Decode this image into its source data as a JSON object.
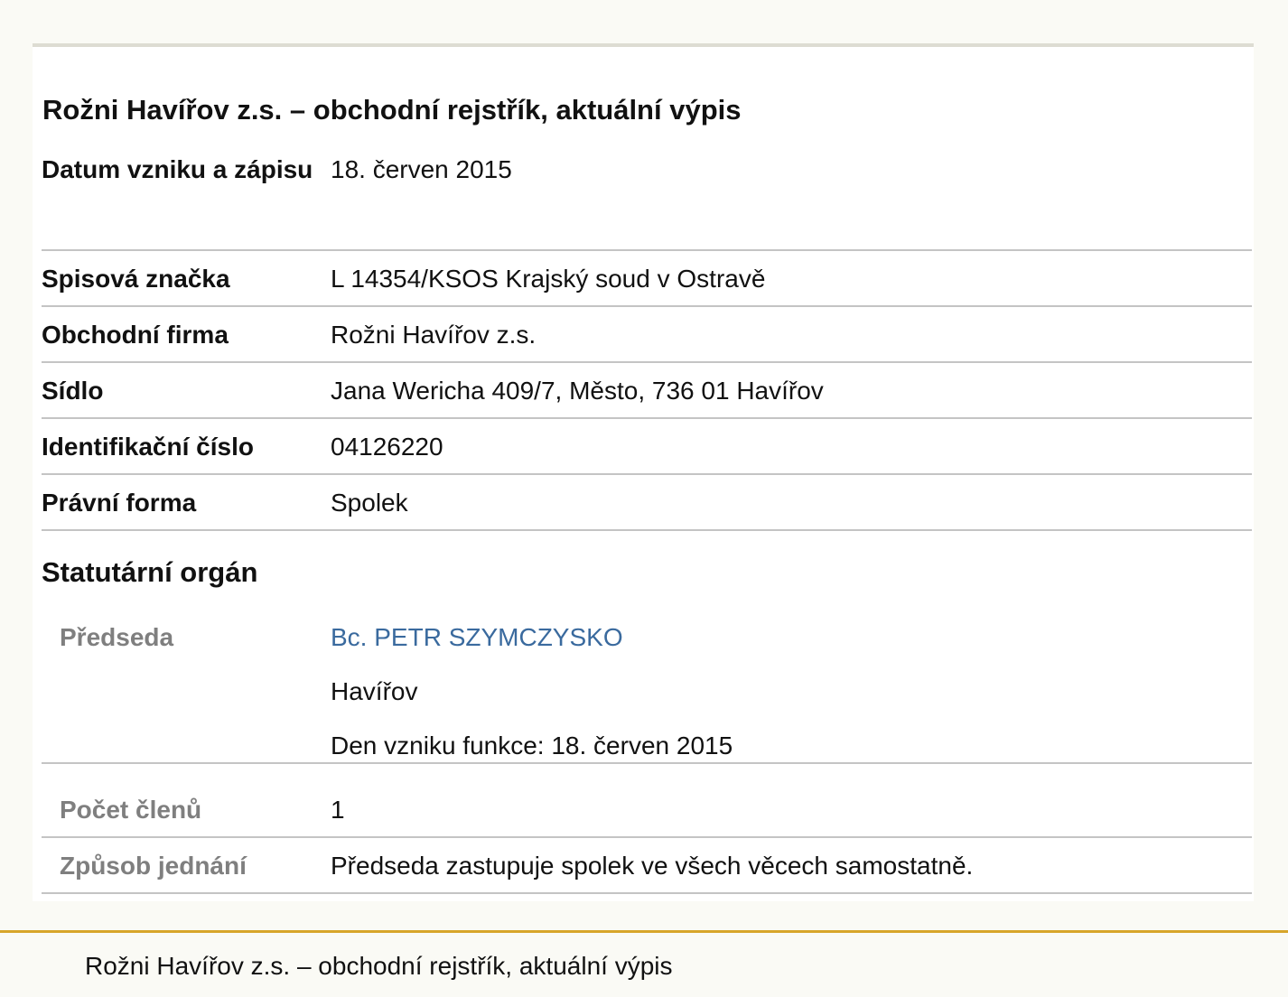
{
  "document": {
    "title": "Rožni Havířov z.s. – obchodní rejstřík, aktuální výpis",
    "rows": [
      {
        "label": "Datum vzniku a zápisu",
        "value": "18. červen 2015"
      },
      {
        "label": "Spisová značka",
        "value": "L 14354/KSOS Krajský soud v Ostravě"
      },
      {
        "label": "Obchodní firma",
        "value": "Rožni Havířov z.s."
      },
      {
        "label": "Sídlo",
        "value": "Jana Wericha 409/7, Město, 736 01 Havířov"
      },
      {
        "label": "Identifikační číslo",
        "value": "04126220"
      },
      {
        "label": "Právní forma",
        "value": "Spolek"
      }
    ],
    "statutory": {
      "heading": "Statutární orgán",
      "chair": {
        "label": "Předseda",
        "name": "Bc. PETR SZYMCZYSKO",
        "city": "Havířov",
        "since": "Den vzniku funkce: 18. červen 2015"
      },
      "members": {
        "label": "Počet členů",
        "value": "1"
      },
      "conduct": {
        "label": "Způsob jednání",
        "value": "Předseda zastupuje spolek ve všech věcech samostatně."
      }
    }
  },
  "footer": {
    "text": "Rožni Havířov z.s. – obchodní rejstřík, aktuální výpis"
  }
}
